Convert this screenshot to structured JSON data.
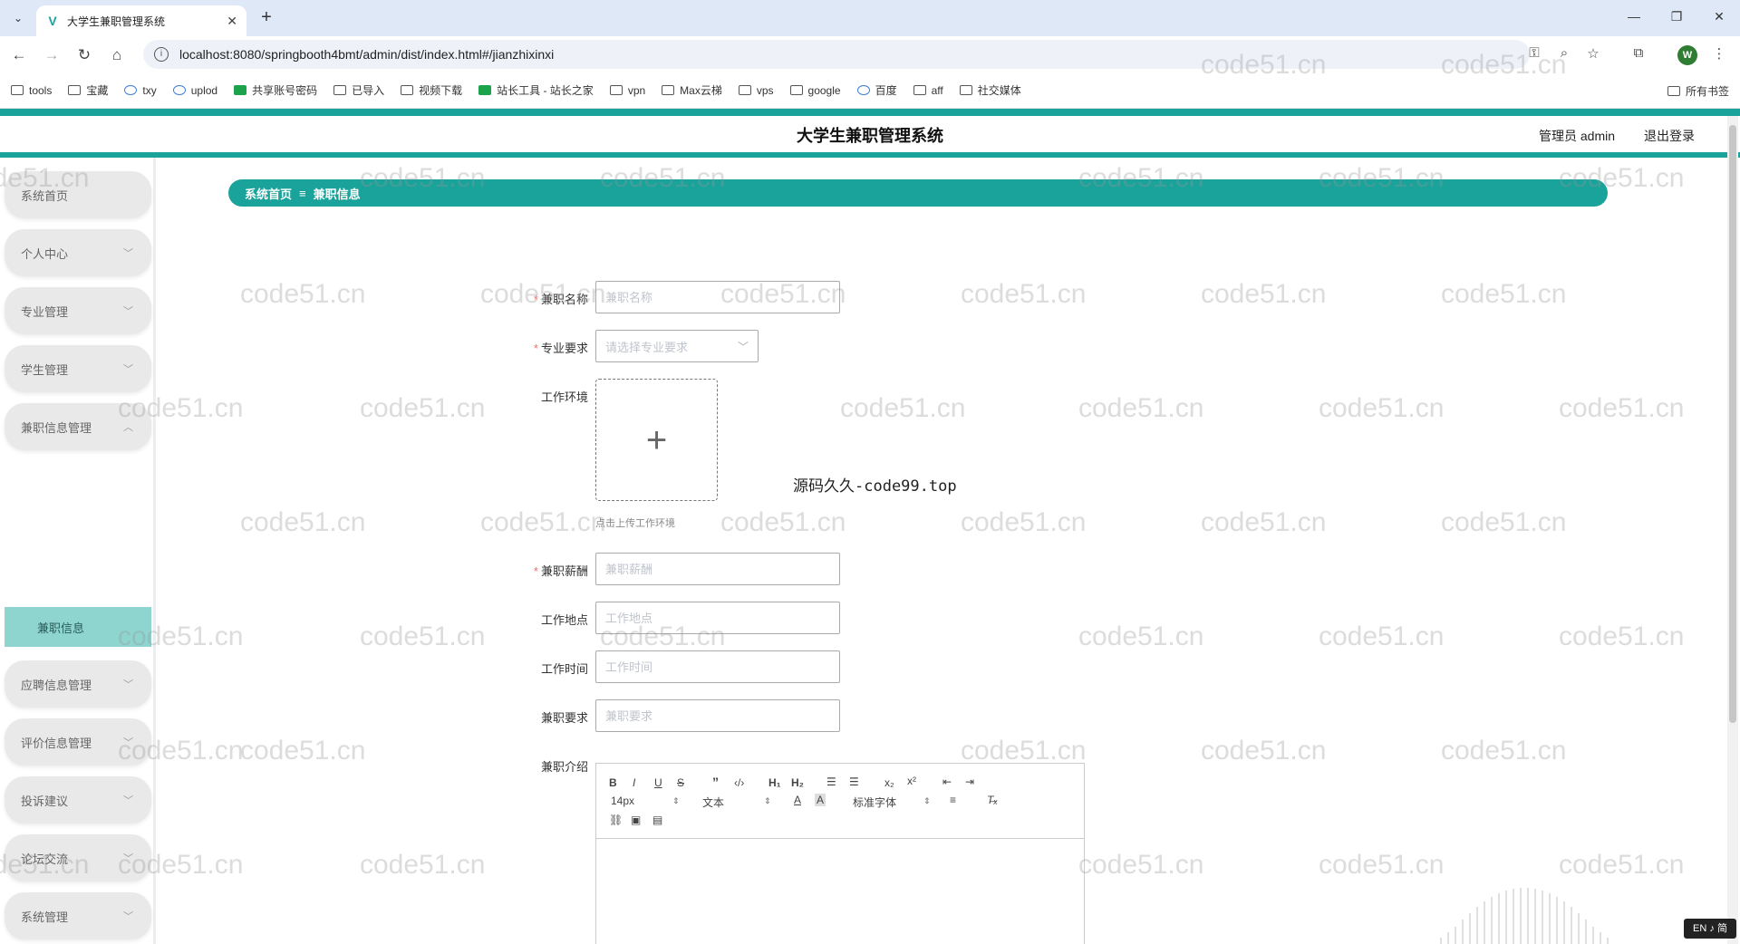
{
  "browser": {
    "tab_title": "大学生兼职管理系统",
    "url": "localhost:8080/springbooth4bmt/admin/dist/index.html#/jianzhixinxi",
    "profile_initial": "W",
    "bookmarks": [
      "tools",
      "宝藏",
      "txy",
      "uplod",
      "共享账号密码",
      "已导入",
      "视频下载",
      "站长工具 - 站长之家",
      "vpn",
      "Max云梯",
      "vps",
      "google",
      "百度",
      "aff",
      "社交媒体"
    ],
    "all_bookmarks": "所有书签"
  },
  "app": {
    "title": "大学生兼职管理系统",
    "admin_label": "管理员 admin",
    "logout": "退出登录"
  },
  "sidebar": {
    "items": [
      {
        "label": "系统首页",
        "chevron": false
      },
      {
        "label": "个人中心",
        "chevron": true
      },
      {
        "label": "专业管理",
        "chevron": true
      },
      {
        "label": "学生管理",
        "chevron": true
      },
      {
        "label": "兼职信息管理",
        "chevron": true,
        "expanded": true
      },
      {
        "label": "应聘信息管理",
        "chevron": true
      },
      {
        "label": "评价信息管理",
        "chevron": true
      },
      {
        "label": "投诉建议",
        "chevron": true
      },
      {
        "label": "论坛交流",
        "chevron": true
      },
      {
        "label": "系统管理",
        "chevron": true
      }
    ],
    "active_sub": "兼职信息"
  },
  "breadcrumb": {
    "home": "系统首页",
    "separator": "≡",
    "current": "兼职信息"
  },
  "form": {
    "name": {
      "label": "兼职名称",
      "placeholder": "兼职名称",
      "required": true
    },
    "major": {
      "label": "专业要求",
      "placeholder": "请选择专业要求",
      "required": true
    },
    "environment": {
      "label": "工作环境",
      "hint": "点击上传工作环境",
      "required": false
    },
    "salary": {
      "label": "兼职薪酬",
      "placeholder": "兼职薪酬",
      "required": true
    },
    "location": {
      "label": "工作地点",
      "placeholder": "工作地点",
      "required": false
    },
    "time": {
      "label": "工作时间",
      "placeholder": "工作时间",
      "required": false
    },
    "requirement": {
      "label": "兼职要求",
      "placeholder": "兼职要求",
      "required": false
    },
    "intro": {
      "label": "兼职介绍"
    }
  },
  "editor": {
    "font_size": "14px",
    "header": "文本",
    "font": "标准字体"
  },
  "overlay_text": "源码久久-code99.top",
  "watermark": "code51.cn",
  "ime": "EN ♪ 简"
}
